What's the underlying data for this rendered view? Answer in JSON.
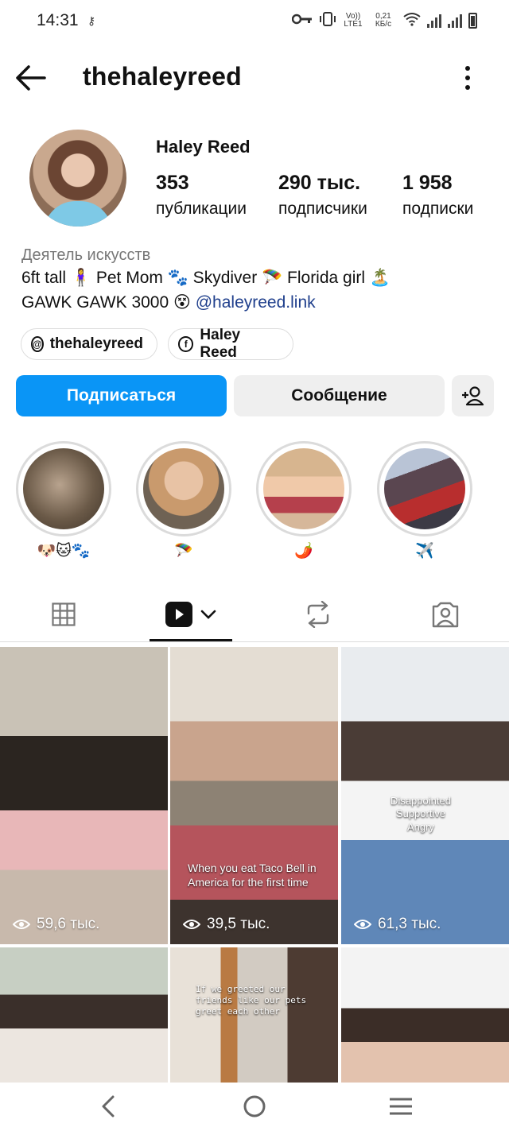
{
  "status_bar": {
    "time": "14:31",
    "network_label": "Vo)) LTE1",
    "speed": "0,21 КБ/с"
  },
  "header": {
    "username": "thehaleyreed"
  },
  "profile": {
    "full_name": "Haley Reed",
    "stats": [
      {
        "value": "353",
        "label": "публикации"
      },
      {
        "value": "290 тыс.",
        "label": "подписчики"
      },
      {
        "value": "1 958",
        "label": "подписки"
      }
    ],
    "category": "Деятель искусств",
    "bio_line1": "6ft tall 🧍‍♀️ Pet Mom 🐾 Skydiver 🪂 Florida girl 🏝️",
    "bio_line2_text": "GAWK GAWK 3000 😵 ",
    "bio_link": "@haleyreed.link",
    "chips": [
      {
        "icon": "threads-icon",
        "label": "thehaleyreed"
      },
      {
        "icon": "facebook-icon",
        "label": "Haley Reed"
      }
    ]
  },
  "actions": {
    "follow_label": "Подписаться",
    "message_label": "Сообщение"
  },
  "highlights": [
    {
      "caption": "🐶🐱🐾"
    },
    {
      "caption": "🪂"
    },
    {
      "caption": "🌶️"
    },
    {
      "caption": "✈️"
    }
  ],
  "grid": [
    {
      "views": "59,6 тыс.",
      "overlay": ""
    },
    {
      "views": "39,5 тыс.",
      "overlay": "When you eat Taco Bell in America for the first time"
    },
    {
      "views": "61,3 тыс.",
      "overlay": "Disappointed Supportive Angry"
    },
    {
      "views": "",
      "overlay": ""
    },
    {
      "views": "",
      "overlay": "If we greeted our friends like our pets greet each other"
    },
    {
      "views": "",
      "overlay": ""
    }
  ],
  "colors": {
    "accent": "#0a95f6",
    "link": "#1f3f8c",
    "secondary_button": "#efefef"
  }
}
